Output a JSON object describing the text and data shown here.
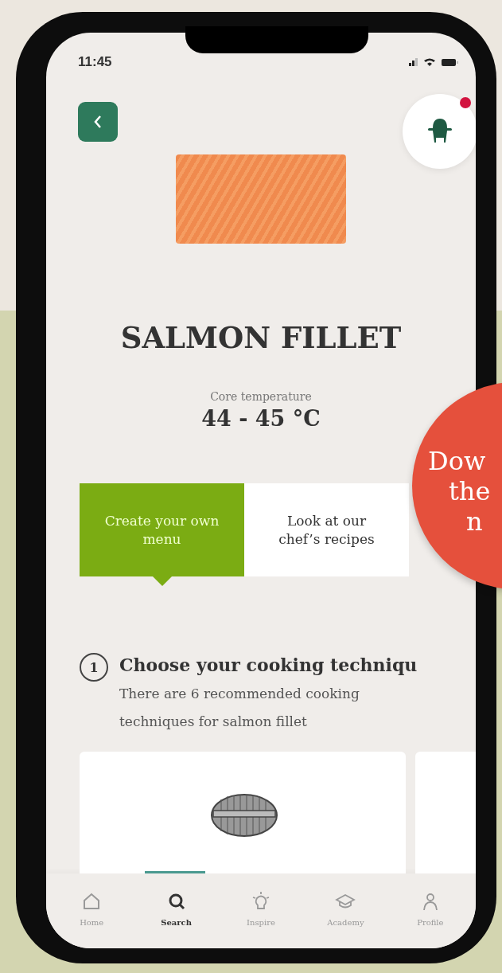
{
  "status_bar": {
    "time": "11:45"
  },
  "notification": {
    "unread": true
  },
  "product": {
    "title": "SALMON FILLET",
    "temperature_label": "Core temperature",
    "temperature": "44 - 45 °C"
  },
  "mode_tabs": [
    {
      "label": "Create your own menu",
      "selected": true
    },
    {
      "label": "Look at our chef’s recipes",
      "selected": false
    }
  ],
  "step": {
    "number": "1",
    "title": "Choose your cooking techniqu",
    "description": "There are 6 recommended cooking techniques for salmon fillet"
  },
  "bottom_nav": [
    {
      "label": "Home",
      "selected": false
    },
    {
      "label": "Search",
      "selected": true
    },
    {
      "label": "Inspire",
      "selected": false
    },
    {
      "label": "Academy",
      "selected": false
    },
    {
      "label": "Profile",
      "selected": false
    }
  ],
  "promo_badge": {
    "lines": [
      "Dow",
      "the",
      "n"
    ]
  }
}
